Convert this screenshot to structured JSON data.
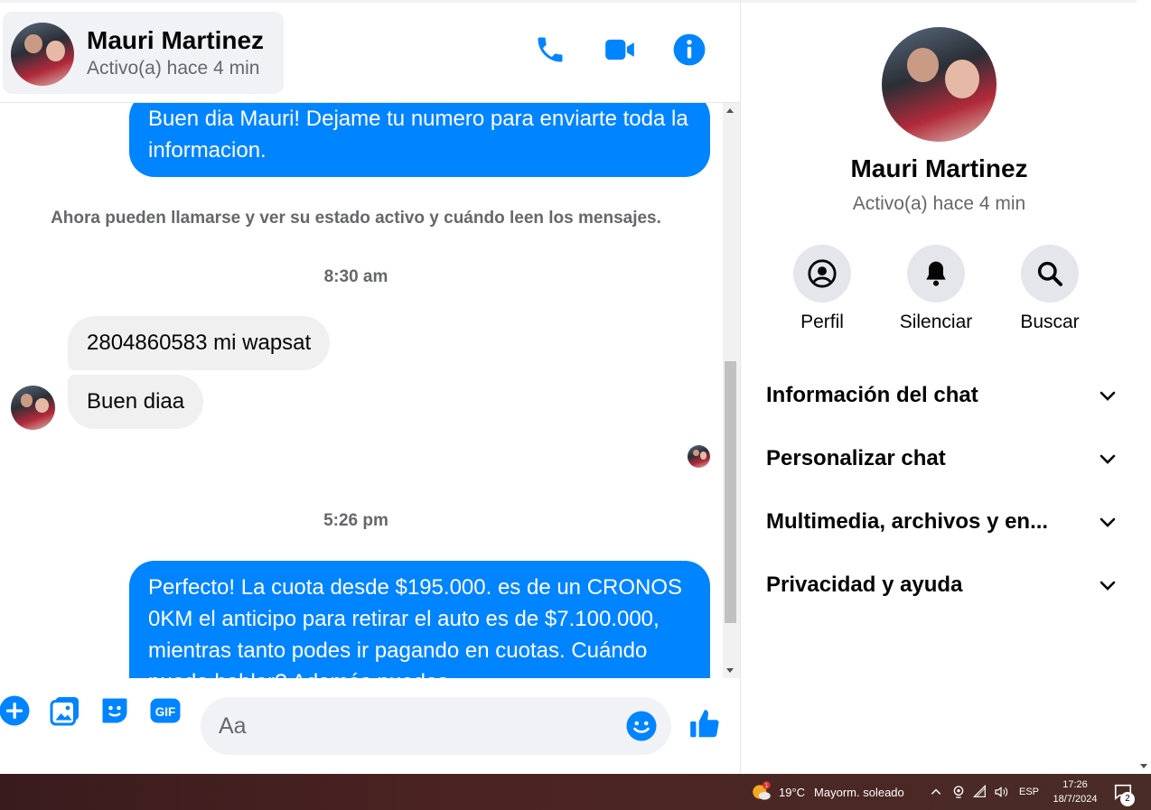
{
  "contact": {
    "name": "Mauri Martinez",
    "status": "Activo(a) hace 4 min"
  },
  "messages": {
    "out1": "Buen dia Mauri! Dejame tu numero para enviarte toda la informacion.",
    "system_note": "Ahora pueden llamarse y ver su estado activo y cuándo leen los mensajes.",
    "time1": "8:30 am",
    "in1": "2804860583 mi wapsat",
    "in2": "Buen diaa",
    "time2": "5:26 pm",
    "out2": "Perfecto! La cuota desde $195.000. es de un CRONOS 0KM el anticipo para retirar el auto es de $7.100.000, mientras tanto podes ir pagando en cuotas. Cuándo puedo hablar? Además puedes"
  },
  "composer": {
    "placeholder": "Aa"
  },
  "info_panel": {
    "actions": [
      "Perfil",
      "Silenciar",
      "Buscar"
    ],
    "sections": [
      "Información del chat",
      "Personalizar chat",
      "Multimedia, archivos y en...",
      "Privacidad y ayuda"
    ]
  },
  "taskbar": {
    "weather_temp": "19°C",
    "weather_desc": "Mayorm. soleado",
    "lang": "ESP",
    "time": "17:26",
    "date": "18/7/2024",
    "notif_count": "2",
    "weather_badge": "1"
  },
  "colors": {
    "accent": "#0084ff",
    "bubble_in": "#f0f0f0",
    "muted_text": "#65676b"
  }
}
